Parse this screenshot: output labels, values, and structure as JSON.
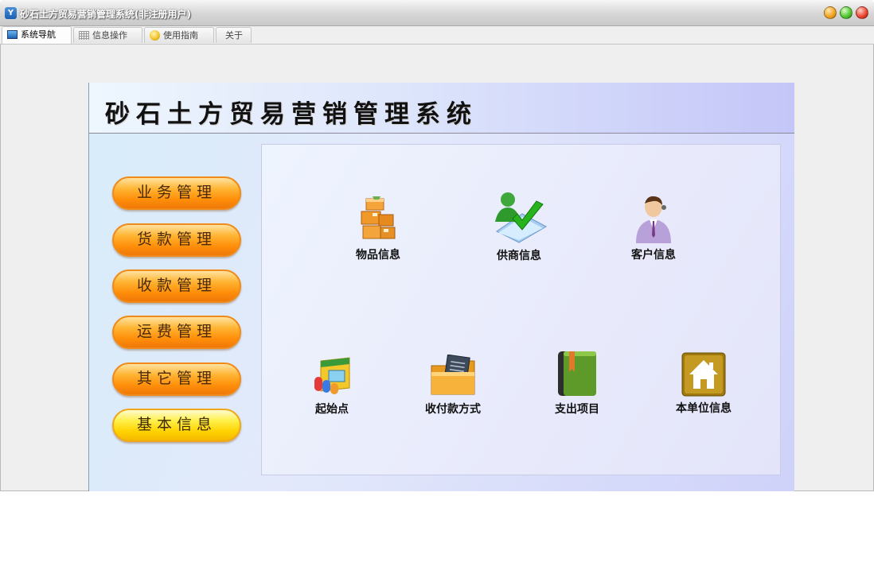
{
  "window": {
    "title": "砂石土方贸易营销管理系统(非注册用户)",
    "app_icon": "Y"
  },
  "tabs": [
    {
      "label": "系统导航",
      "icon": "navigation-icon"
    },
    {
      "label": "信息操作",
      "icon": "grid-icon"
    },
    {
      "label": "使用指南",
      "icon": "guide-icon"
    },
    {
      "label": "关于",
      "icon": ""
    }
  ],
  "header": {
    "title": "砂石土方贸易营销管理系统"
  },
  "menu": [
    {
      "label": "业务管理"
    },
    {
      "label": "货款管理"
    },
    {
      "label": "收款管理"
    },
    {
      "label": "运费管理"
    },
    {
      "label": "其它管理"
    },
    {
      "label": "基本信息"
    }
  ],
  "features": [
    {
      "label": "物品信息",
      "icon": "boxes-icon"
    },
    {
      "label": "供商信息",
      "icon": "supplier-check-icon"
    },
    {
      "label": "客户信息",
      "icon": "customer-person-icon"
    },
    {
      "label": "起始点",
      "icon": "shop-icon"
    },
    {
      "label": "收付款方式",
      "icon": "folder-document-icon"
    },
    {
      "label": "支出项目",
      "icon": "book-icon"
    },
    {
      "label": "本单位信息",
      "icon": "house-icon"
    }
  ],
  "colors": {
    "menu_orange": "#ff9f1a",
    "menu_yellow": "#ffe62a",
    "panel_bg": "#e2e7fb"
  }
}
